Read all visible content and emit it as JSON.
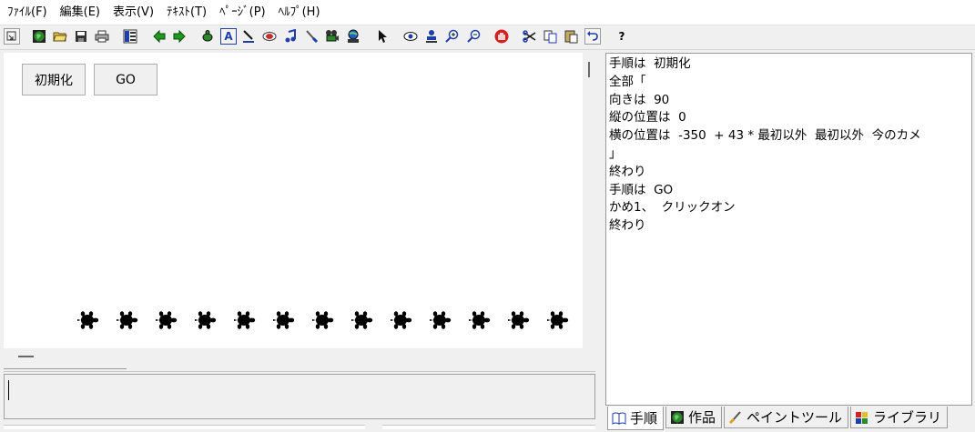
{
  "menu": [
    "ﾌｧｲﾙ(F)",
    "編集(E)",
    "表示(V)",
    "ﾃｷｽﾄ(T)",
    "ﾍﾟｰｼﾞ(P)",
    "ﾍﾙﾌﾟ(H)"
  ],
  "toolbar": {
    "icons": [
      "window-restore-icon",
      "globe-icon",
      "open-folder-icon",
      "save-disk-icon",
      "printer-icon",
      "layout-icon",
      "back-arrow-icon",
      "forward-arrow-icon",
      "turtle-icon",
      "text-box-icon",
      "pen-tool-icon",
      "stamp-icon",
      "music-note-icon",
      "paint-brush-icon",
      "movie-camera-icon",
      "world-network-icon",
      "cursor-arrow-icon",
      "eye-icon",
      "person-icon",
      "zoom-in-icon",
      "zoom-out-icon",
      "hand-stop-icon",
      "scissors-icon",
      "copy-icon",
      "paste-icon",
      "undo-icon",
      "help-icon"
    ],
    "help_label": "?",
    "text_box_label": "A"
  },
  "stage": {
    "buttons": [
      {
        "label": "初期化"
      },
      {
        "label": "GO"
      }
    ],
    "turtle_count": 13
  },
  "code_lines": [
    "手順は  初期化",
    "全部「",
    "向きは  90",
    "縦の位置は  0",
    "横の位置は  -350  + 43 * 最初以外  最初以外  今のカメ",
    "」",
    "終わり",
    "手順は  GO",
    "かめ1、  クリックオン",
    "終わり"
  ],
  "tabs": [
    {
      "label": "手順",
      "icon": "book-icon"
    },
    {
      "label": "作品",
      "icon": "globe-icon"
    },
    {
      "label": "ペイントツール",
      "icon": "paint-brush-icon"
    },
    {
      "label": "ライブラリ",
      "icon": "library-icon"
    }
  ],
  "colors": {
    "turtle": "#000000",
    "stop_button": "#d42020",
    "arrow_green": "#1f9a1f",
    "globe_green": "#2a8a2a"
  }
}
